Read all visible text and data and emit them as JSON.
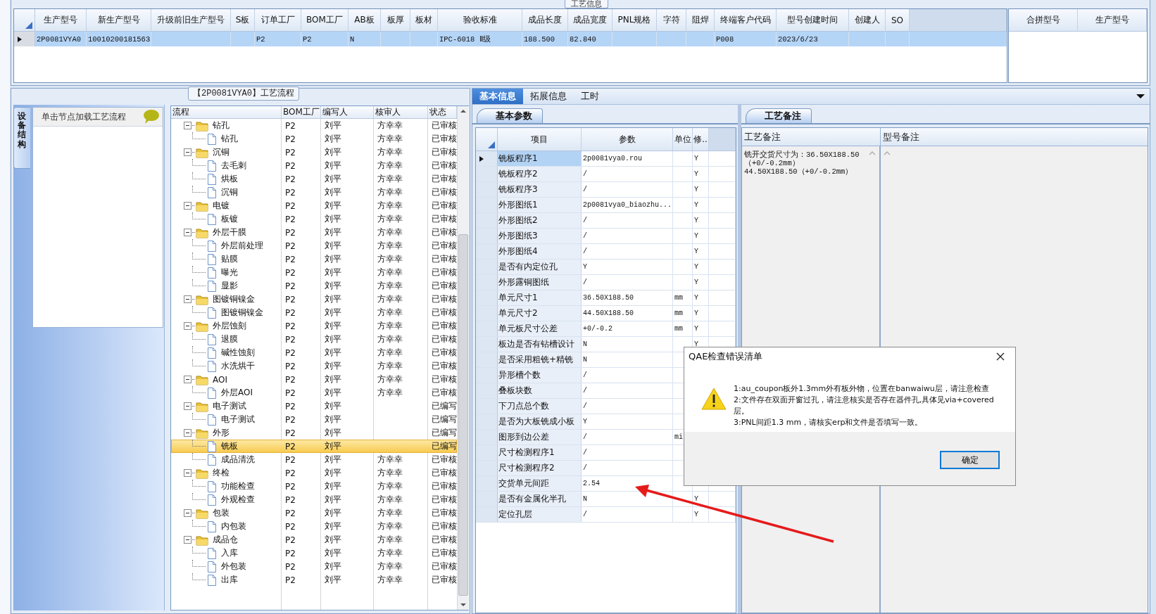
{
  "group_title": "工艺信息",
  "main_grid": {
    "columns": [
      "生产型号",
      "新生产型号",
      "升级前旧生产型号",
      "S板",
      "订单工厂",
      "BOM工厂",
      "AB板",
      "板厚",
      "板材",
      "验收标准",
      "成品长度",
      "成品宽度",
      "PNL规格",
      "字符",
      "阻焊",
      "终端客户代码",
      "型号创建时间",
      "创建人",
      "SO"
    ],
    "rows": [
      {
        "selected": true,
        "cells": [
          "2P0081VYA0",
          "10010200181563",
          null,
          null,
          "P2",
          "P2",
          "N",
          null,
          null,
          "IPC-6018 Ⅱ级",
          "188.500",
          "82.840",
          null,
          null,
          null,
          "P008",
          "2023/6/23",
          null,
          null
        ]
      }
    ]
  },
  "merge_grid": {
    "columns": [
      "合拼型号",
      "生产型号"
    ]
  },
  "flow_panel": {
    "title": "【2P0081VYA0】工艺流程",
    "side_tab": "设备结构",
    "hint": "单击节点加载工艺流程",
    "columns": [
      "流程",
      "BOM工厂",
      "编写人",
      "核审人",
      "状态"
    ],
    "tree": [
      {
        "name": "钻孔",
        "bom": "P2",
        "writer": "刘平",
        "reviewer": "方幸幸",
        "status": "已审核",
        "selected": false,
        "expanded": true,
        "children": [
          {
            "name": "钻孔",
            "bom": "P2",
            "writer": "刘平",
            "reviewer": "方幸幸",
            "status": "已审核",
            "selected": false
          }
        ]
      },
      {
        "name": "沉铜",
        "bom": "P2",
        "writer": "刘平",
        "reviewer": "方幸幸",
        "status": "已审核",
        "selected": false,
        "expanded": true,
        "children": [
          {
            "name": "去毛刺",
            "bom": "P2",
            "writer": "刘平",
            "reviewer": "方幸幸",
            "status": "已审核",
            "selected": false
          },
          {
            "name": "烘板",
            "bom": "P2",
            "writer": "刘平",
            "reviewer": "方幸幸",
            "status": "已审核",
            "selected": false
          },
          {
            "name": "沉铜",
            "bom": "P2",
            "writer": "刘平",
            "reviewer": "方幸幸",
            "status": "已审核",
            "selected": false
          }
        ]
      },
      {
        "name": "电镀",
        "bom": "P2",
        "writer": "刘平",
        "reviewer": "方幸幸",
        "status": "已审核",
        "selected": false,
        "expanded": true,
        "children": [
          {
            "name": "板镀",
            "bom": "P2",
            "writer": "刘平",
            "reviewer": "方幸幸",
            "status": "已审核",
            "selected": false
          }
        ]
      },
      {
        "name": "外层干膜",
        "bom": "P2",
        "writer": "刘平",
        "reviewer": "方幸幸",
        "status": "已审核",
        "selected": false,
        "expanded": true,
        "children": [
          {
            "name": "外层前处理",
            "bom": "P2",
            "writer": "刘平",
            "reviewer": "方幸幸",
            "status": "已审核",
            "selected": false
          },
          {
            "name": "贴膜",
            "bom": "P2",
            "writer": "刘平",
            "reviewer": "方幸幸",
            "status": "已审核",
            "selected": false
          },
          {
            "name": "曝光",
            "bom": "P2",
            "writer": "刘平",
            "reviewer": "方幸幸",
            "status": "已审核",
            "selected": false
          },
          {
            "name": "显影",
            "bom": "P2",
            "writer": "刘平",
            "reviewer": "方幸幸",
            "status": "已审核",
            "selected": false
          }
        ]
      },
      {
        "name": "图镀铜镍金",
        "bom": "P2",
        "writer": "刘平",
        "reviewer": "方幸幸",
        "status": "已审核",
        "selected": false,
        "expanded": true,
        "children": [
          {
            "name": "图镀铜镍金",
            "bom": "P2",
            "writer": "刘平",
            "reviewer": "方幸幸",
            "status": "已审核",
            "selected": false
          }
        ]
      },
      {
        "name": "外层蚀刻",
        "bom": "P2",
        "writer": "刘平",
        "reviewer": "方幸幸",
        "status": "已审核",
        "selected": false,
        "expanded": true,
        "children": [
          {
            "name": "退膜",
            "bom": "P2",
            "writer": "刘平",
            "reviewer": "方幸幸",
            "status": "已审核",
            "selected": false
          },
          {
            "name": "碱性蚀刻",
            "bom": "P2",
            "writer": "刘平",
            "reviewer": "方幸幸",
            "status": "已审核",
            "selected": false
          },
          {
            "name": "水洗烘干",
            "bom": "P2",
            "writer": "刘平",
            "reviewer": "方幸幸",
            "status": "已审核",
            "selected": false
          }
        ]
      },
      {
        "name": "AOI",
        "bom": "P2",
        "writer": "刘平",
        "reviewer": "方幸幸",
        "status": "已审核",
        "selected": false,
        "expanded": true,
        "children": [
          {
            "name": "外层AOI",
            "bom": "P2",
            "writer": "刘平",
            "reviewer": "方幸幸",
            "status": "已审核",
            "selected": false
          }
        ]
      },
      {
        "name": "电子测试",
        "bom": "P2",
        "writer": "刘平",
        "status": "已编写",
        "selected": false,
        "expanded": true,
        "children": [
          {
            "name": "电子测试",
            "bom": "P2",
            "writer": "刘平",
            "status": "已编写",
            "selected": false
          }
        ]
      },
      {
        "name": "外形",
        "bom": "P2",
        "writer": "刘平",
        "status": "已编写",
        "selected": false,
        "expanded": true,
        "children": [
          {
            "name": "铣板",
            "bom": "P2",
            "writer": "刘平",
            "status": "已编写",
            "selected": true
          },
          {
            "name": "成品清洗",
            "bom": "P2",
            "writer": "刘平",
            "reviewer": "方幸幸",
            "status": "已审核",
            "selected": false
          }
        ]
      },
      {
        "name": "终检",
        "bom": "P2",
        "writer": "刘平",
        "reviewer": "方幸幸",
        "status": "已审核",
        "selected": false,
        "expanded": true,
        "children": [
          {
            "name": "功能检查",
            "bom": "P2",
            "writer": "刘平",
            "reviewer": "方幸幸",
            "status": "已审核",
            "selected": false
          },
          {
            "name": "外观检查",
            "bom": "P2",
            "writer": "刘平",
            "reviewer": "方幸幸",
            "status": "已审核",
            "selected": false
          }
        ]
      },
      {
        "name": "包装",
        "bom": "P2",
        "writer": "刘平",
        "reviewer": "方幸幸",
        "status": "已审核",
        "selected": false,
        "expanded": true,
        "children": [
          {
            "name": "内包装",
            "bom": "P2",
            "writer": "刘平",
            "reviewer": "方幸幸",
            "status": "已审核",
            "selected": false
          }
        ]
      },
      {
        "name": "成品仓",
        "bom": "P2",
        "writer": "刘平",
        "reviewer": "方幸幸",
        "status": "已审核",
        "selected": false,
        "expanded": true,
        "children": [
          {
            "name": "入库",
            "bom": "P2",
            "writer": "刘平",
            "reviewer": "方幸幸",
            "status": "已审核",
            "selected": false
          },
          {
            "name": "外包装",
            "bom": "P2",
            "writer": "刘平",
            "reviewer": "方幸幸",
            "status": "已审核",
            "selected": false
          },
          {
            "name": "出库",
            "bom": "P2",
            "writer": "刘平",
            "reviewer": "方幸幸",
            "status": "已审核",
            "selected": false
          }
        ]
      }
    ]
  },
  "detail_tabs": [
    {
      "label": "基本信息",
      "selected": true
    },
    {
      "label": "拓展信息",
      "selected": false
    },
    {
      "label": "工时",
      "selected": false
    }
  ],
  "param_tabs": [
    {
      "label": "基本参数",
      "selected": true
    }
  ],
  "param_grid": {
    "columns": [
      "项目",
      "参数",
      "单位",
      "修.."
    ],
    "rows": [
      {
        "item": "铣板程序1",
        "value": "2p0081vya0.rou",
        "flag": "Y",
        "selected": true
      },
      {
        "item": "铣板程序2",
        "value": "/",
        "flag": "Y",
        "selected": false
      },
      {
        "item": "铣板程序3",
        "value": "/",
        "flag": "Y",
        "selected": false
      },
      {
        "item": "外形图纸1",
        "value": "2p0081vya0_biaozhu...",
        "flag": "Y",
        "selected": false
      },
      {
        "item": "外形图纸2",
        "value": "/",
        "flag": "Y",
        "selected": false
      },
      {
        "item": "外形图纸3",
        "value": "/",
        "flag": "Y",
        "selected": false
      },
      {
        "item": "外形图纸4",
        "value": "/",
        "flag": "Y",
        "selected": false
      },
      {
        "item": "是否有内定位孔",
        "value": "Y",
        "flag": "Y",
        "selected": false
      },
      {
        "item": "外形露铜图纸",
        "value": "/",
        "flag": "Y",
        "selected": false
      },
      {
        "item": "单元尺寸1",
        "value": "36.50X188.50",
        "unit": "mm",
        "flag": "Y",
        "selected": false
      },
      {
        "item": "单元尺寸2",
        "value": "44.50X188.50",
        "unit": "mm",
        "flag": "Y",
        "selected": false
      },
      {
        "item": "单元板尺寸公差",
        "value": "+0/-0.2",
        "unit": "mm",
        "flag": "Y",
        "selected": false
      },
      {
        "item": "板边是否有钻槽设计",
        "value": "N",
        "flag": "Y",
        "selected": false
      },
      {
        "item": "是否采用粗铣+精铣",
        "value": "N",
        "selected": false
      },
      {
        "item": "异形槽个数",
        "value": "/",
        "selected": false
      },
      {
        "item": "叠板块数",
        "value": "/",
        "selected": false
      },
      {
        "item": "下刀点总个数",
        "value": "/",
        "selected": false
      },
      {
        "item": "是否为大板铣成小板",
        "value": "Y",
        "selected": false
      },
      {
        "item": "图形到边公差",
        "value": "/",
        "unit": "mi",
        "selected": false
      },
      {
        "item": "尺寸检测程序1",
        "value": "/",
        "selected": false
      },
      {
        "item": "尺寸检测程序2",
        "value": "/",
        "selected": false
      },
      {
        "item": "交货单元间距",
        "value": "2.54",
        "selected": false
      },
      {
        "item": "是否有金属化半孔",
        "value": "N",
        "flag": "Y",
        "selected": false
      },
      {
        "item": "定位孔层",
        "value": "/",
        "flag": "Y",
        "selected": false
      }
    ]
  },
  "note_tabs": [
    {
      "label": "工艺备注",
      "selected": true
    }
  ],
  "notes_grid": {
    "columns": [
      "工艺备注",
      "型号备注"
    ],
    "process_note": [
      "铣开交货尺寸为：36.50X188.50（+0/-0.2mm）",
      "44.50X188.50（+0/-0.2mm）"
    ]
  },
  "dialog": {
    "title": "QAE检查错误清单",
    "messages": [
      "1:au_coupon板外1.3mm外有板外物，位置在banwaiwu层，请注意检查",
      "2:文件存在双面开窗过孔，请注意核实是否存在器件孔,具体见via+covered层。",
      "3:PNL间距1.3 mm，请核实erp和文件是否填写一致。"
    ],
    "buttons": [
      "确定"
    ]
  }
}
